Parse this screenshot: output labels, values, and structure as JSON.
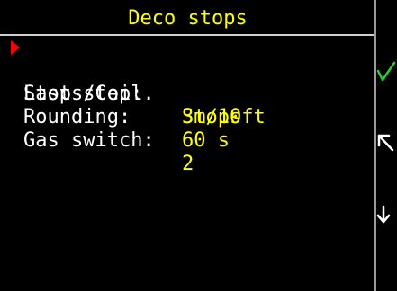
{
  "header": {
    "title": "Deco stops"
  },
  "menu": {
    "items": [
      {
        "label": "Stops/Ceil.",
        "value": "Stops",
        "selected": true
      },
      {
        "label": "Last stop:",
        "value": "3m/10ft",
        "selected": false
      },
      {
        "label": "Rounding:",
        "value": "60 s",
        "selected": false
      },
      {
        "label": "Gas switch:",
        "value": "2",
        "selected": false
      }
    ]
  },
  "sidebar": {
    "buttons": [
      {
        "icon": "check-icon",
        "color": "#2ecc2e"
      },
      {
        "icon": "arrow-up-left-icon",
        "color": "#ffffff"
      },
      {
        "icon": "arrow-down-icon",
        "color": "#ffffff"
      }
    ]
  },
  "colors": {
    "background": "#000000",
    "label": "#ffffff",
    "value": "#ffff00",
    "cursor": "#ff0000",
    "divider": "#cfcfcf"
  }
}
